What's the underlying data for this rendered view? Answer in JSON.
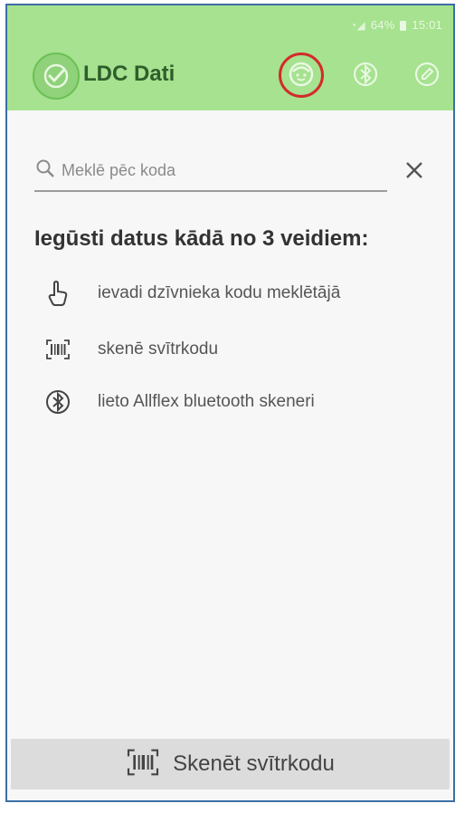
{
  "status_bar": {
    "battery": "64%",
    "time": "15:01"
  },
  "app_bar": {
    "title": "LDC Dati"
  },
  "search": {
    "placeholder": "Meklē pēc koda"
  },
  "main": {
    "heading": "Iegūsti datus kādā no 3 veidiem:",
    "options": [
      {
        "icon": "touch-icon",
        "label": "ievadi dzīvnieka kodu meklētājā"
      },
      {
        "icon": "barcode-icon",
        "label": "skenē svītrkodu"
      },
      {
        "icon": "bluetooth-icon",
        "label": "lieto Allflex bluetooth skeneri"
      }
    ]
  },
  "bottom_button": {
    "label": "Skenēt svītrkodu"
  },
  "colors": {
    "app_bar": "#a6e28f",
    "highlight_ring": "#d32b2b",
    "title": "#2f5d2b"
  }
}
